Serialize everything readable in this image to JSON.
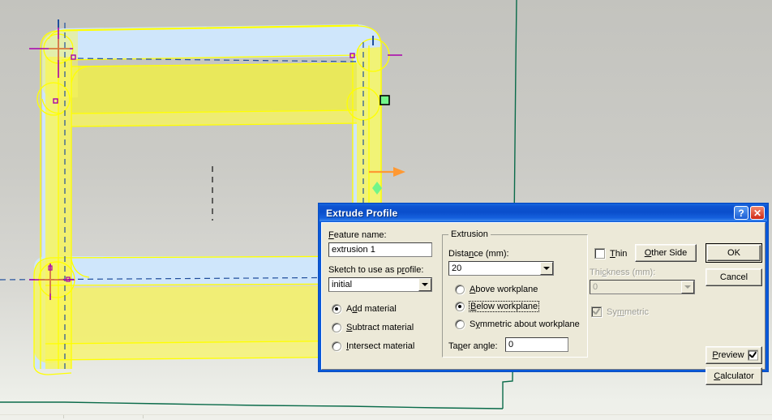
{
  "window": {
    "title": "Extrude Profile",
    "help_button": "?",
    "close_button": "✕"
  },
  "dialog": {
    "feature_name_label": "Feature name:",
    "feature_name_value": "extrusion 1",
    "sketch_label": "Sketch to use as profile:",
    "sketch_value": "initial",
    "material_options": [
      {
        "label": "Add material",
        "selected": true
      },
      {
        "label": "Subtract material",
        "selected": false
      },
      {
        "label": "Intersect material",
        "selected": false
      }
    ],
    "extrusion_group": {
      "legend": "Extrusion",
      "distance_label": "Distance (mm):",
      "distance_value": "20",
      "direction_options": [
        {
          "label": "Above workplane",
          "selected": false
        },
        {
          "label": "Below workplane",
          "selected": true
        },
        {
          "label": "Symmetric about workplane",
          "selected": false
        }
      ],
      "taper_label": "Taper angle:",
      "taper_value": "0"
    },
    "thin_label": "Thin",
    "thin_checked": false,
    "thickness_label": "Thickness (mm):",
    "thickness_value": "0",
    "thickness_enabled": false,
    "symmetric_label": "Symmetric",
    "symmetric_checked": true,
    "symmetric_enabled": false,
    "buttons": {
      "other_side": "Other Side",
      "ok": "OK",
      "cancel": "Cancel",
      "preview": "Preview",
      "preview_checked": true,
      "calculator": "Calculator"
    }
  },
  "viewport": {
    "description": "CAD 3D model view of an extruded rectangular frame profile",
    "colors": {
      "profile_fill": "#ffff00",
      "extrusion_fill": "#cfe6fb",
      "outline": "#ffff00",
      "construction_line": "#1f4e9c",
      "axis_line": "#0a6b4a",
      "handle_green": "#72f58a",
      "arrow_orange": "#ff9933",
      "marker_magenta": "#aa00aa",
      "background_top": "#c3c3be",
      "background_bottom": "#eff0ea"
    }
  }
}
